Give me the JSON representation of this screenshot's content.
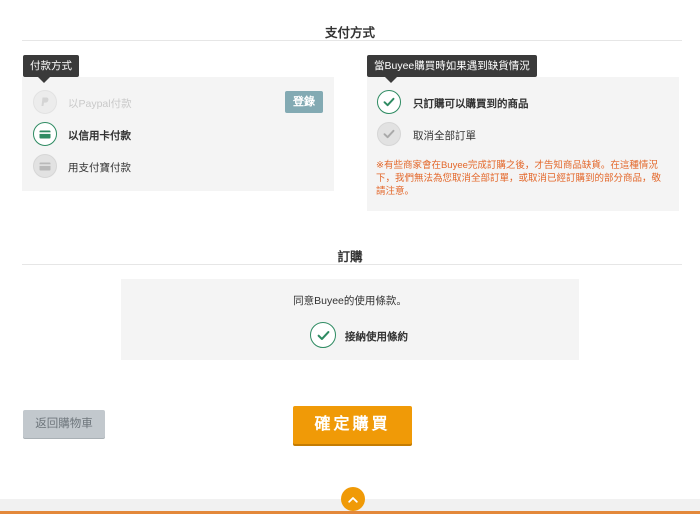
{
  "payment": {
    "title": "支付方式",
    "tooltip": "付款方式",
    "options": [
      {
        "label": "以Paypal付款",
        "icon": "paypal-icon",
        "state": "disabled"
      },
      {
        "label": "以信用卡付款",
        "icon": "credit-card-icon",
        "state": "selected"
      },
      {
        "label": "用支付寶付款",
        "icon": "alipay-card-icon",
        "state": "unselected"
      }
    ],
    "register_button": "登錄"
  },
  "shortage": {
    "tooltip": "當Buyee購買時如果遇到缺貨情況",
    "options": [
      {
        "label": "只訂購可以購買到的商品",
        "state": "selected"
      },
      {
        "label": "取消全部訂單",
        "state": "unselected"
      }
    ],
    "note": "※有些商家會在Buyee完成訂購之後，才告知商品缺貨。在這種情況下，我們無法為您取消全部訂單，或取消已經訂購到的部分商品，敬請注意。"
  },
  "order": {
    "title": "訂購",
    "terms_text": "同意Buyee的使用條款。",
    "accept_label": "接納使用條約"
  },
  "actions": {
    "back": "返回購物車",
    "confirm": "確定購買"
  },
  "colors": {
    "accent_orange": "#f09a07",
    "check_green": "#2e8b62",
    "note_orange": "#e3672a"
  }
}
